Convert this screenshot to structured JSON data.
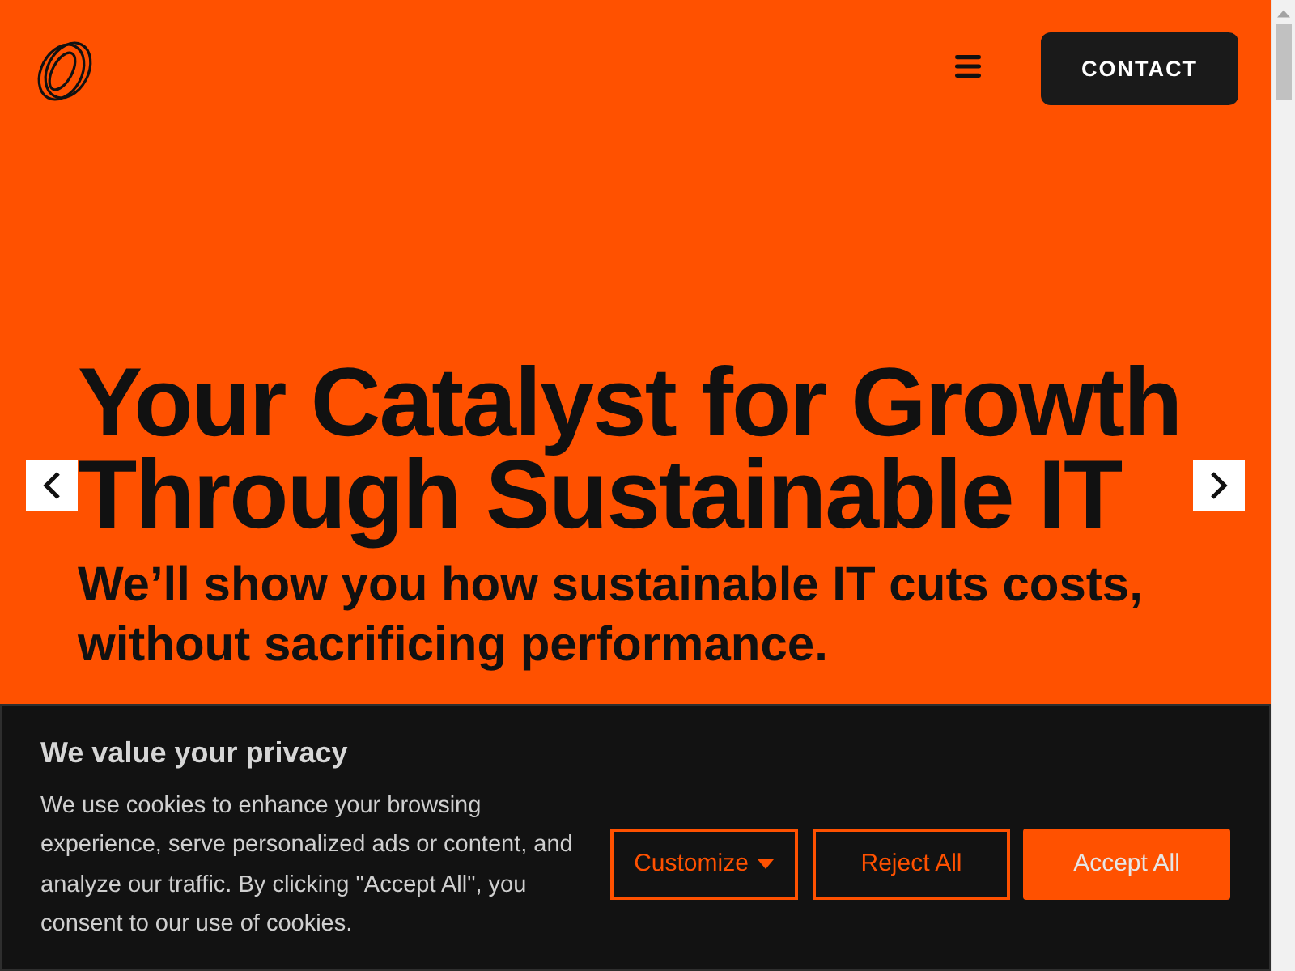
{
  "header": {
    "contact_button": "CONTACT"
  },
  "hero": {
    "title_lines": [
      "Your Catalyst for Growth",
      "Through Sustainable IT"
    ],
    "subtitle": "We’ll show you how sustainable IT cuts costs, without sacrificing performance."
  },
  "cookie_banner": {
    "title": "We value your privacy",
    "text": "We use cookies to enhance your browsing experience, serve personalized ads or content, and analyze our traffic. By clicking \"Accept All\", you consent to our use of cookies.",
    "buttons": [
      {
        "label": "Customize",
        "kind": "dropdown"
      },
      {
        "label": "Reject All",
        "kind": "outline"
      },
      {
        "label": "Accept All",
        "kind": "primary"
      }
    ]
  }
}
